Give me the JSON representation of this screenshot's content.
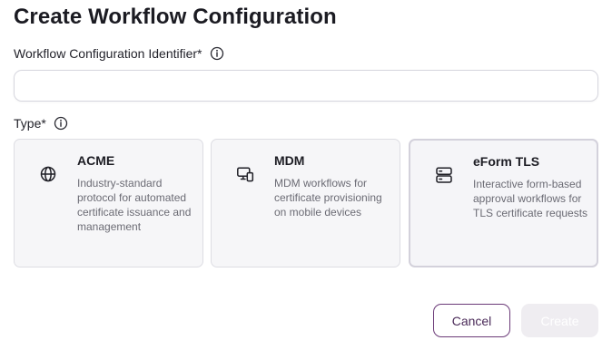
{
  "page": {
    "title": "Create Workflow Configuration"
  },
  "identifier_field": {
    "label": "Workflow Configuration Identifier*",
    "value": "",
    "placeholder": ""
  },
  "type_field": {
    "label": "Type*",
    "selected": "eForm TLS",
    "options": [
      {
        "title": "ACME",
        "description": "Industry-standard protocol for automated certificate issuance and management",
        "icon": "globe-icon"
      },
      {
        "title": "MDM",
        "description": "MDM workflows for certificate provisioning on mobile devices",
        "icon": "devices-icon"
      },
      {
        "title": "eForm TLS",
        "description": "Interactive form-based approval workflows for TLS certificate requests",
        "icon": "server-icon"
      }
    ]
  },
  "actions": {
    "cancel_label": "Cancel",
    "create_label": "Create",
    "create_enabled": false
  },
  "colors": {
    "accent": "#6b3a78",
    "card_background": "#f6f6f8",
    "card_border": "#dddde3",
    "disabled_button": "#efedf1"
  }
}
